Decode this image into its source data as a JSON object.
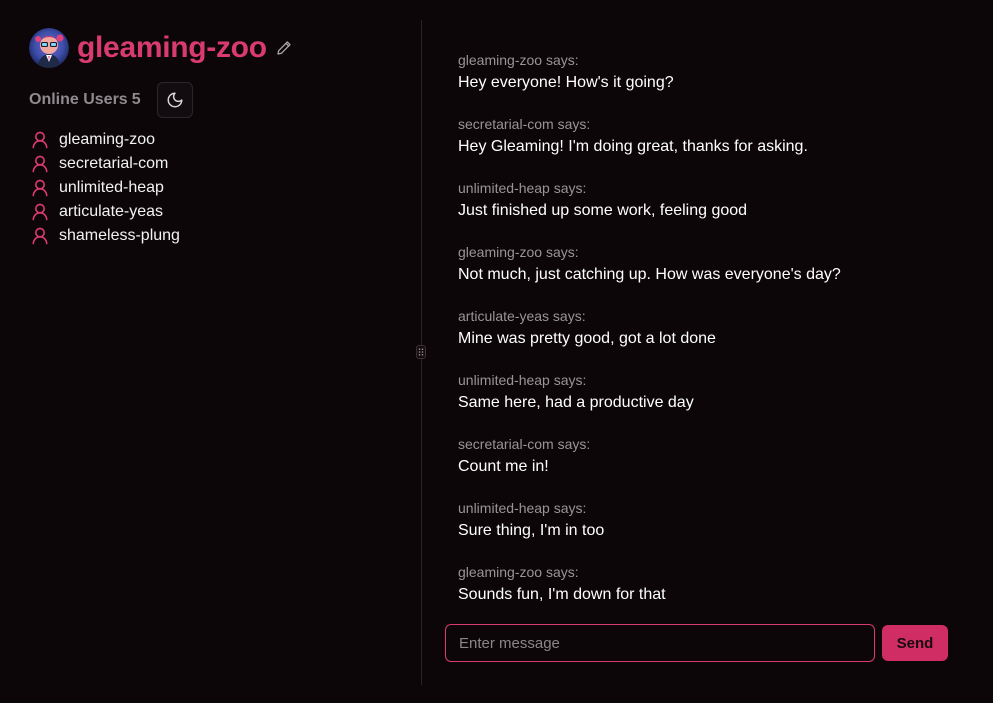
{
  "profile": {
    "username": "gleaming-zoo",
    "avatar_icon": "avatar-icon",
    "edit_icon": "pencil-icon"
  },
  "online": {
    "label": "Online Users",
    "count": "5"
  },
  "theme_icon": "moon-icon",
  "users": [
    "gleaming-zoo",
    "secretarial-com",
    "unlimited-heap",
    "articulate-yeas",
    "shameless-plung"
  ],
  "messages": [
    {
      "sender": "gleaming-zoo says:",
      "text": "Hey everyone! How's it going?"
    },
    {
      "sender": "secretarial-com says:",
      "text": "Hey Gleaming! I'm doing great, thanks for asking."
    },
    {
      "sender": "unlimited-heap says:",
      "text": "Just finished up some work, feeling good"
    },
    {
      "sender": "gleaming-zoo says:",
      "text": "Not much, just catching up. How was everyone's day?"
    },
    {
      "sender": "articulate-yeas says:",
      "text": "Mine was pretty good, got a lot done"
    },
    {
      "sender": "unlimited-heap says:",
      "text": "Same here, had a productive day"
    },
    {
      "sender": "secretarial-com says:",
      "text": "Count me in!"
    },
    {
      "sender": "unlimited-heap says:",
      "text": "Sure thing, I'm in too"
    },
    {
      "sender": "gleaming-zoo says:",
      "text": "Sounds fun, I'm down for that"
    }
  ],
  "composer": {
    "value": "",
    "placeholder": "Enter message",
    "send_label": "Send"
  },
  "colors": {
    "background": "#0c0609",
    "accent": "#d93a70",
    "send_button": "#cf2d63",
    "muted_text": "#9a9497"
  }
}
